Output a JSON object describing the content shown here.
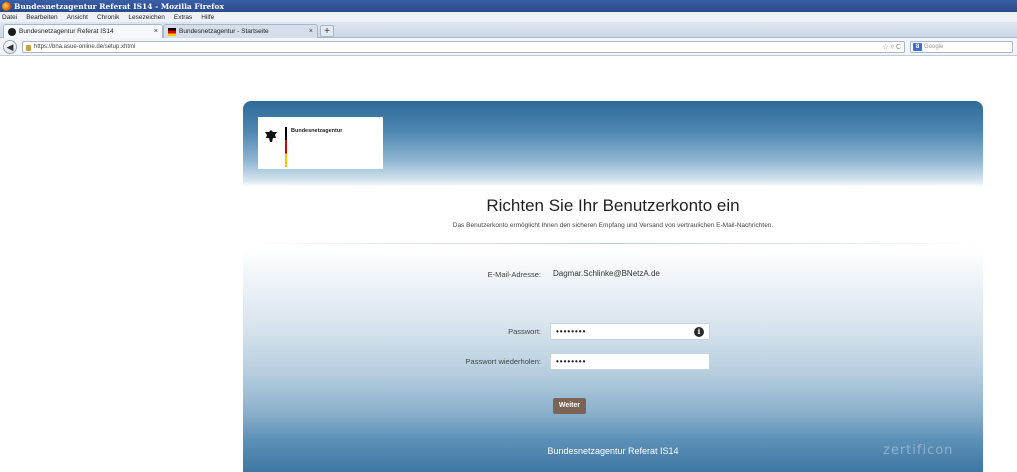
{
  "browser": {
    "window_title": "Bundesnetzagentur Referat IS14 - Mozilla Firefox",
    "menu": [
      "Datei",
      "Bearbeiten",
      "Ansicht",
      "Chronik",
      "Lesezeichen",
      "Extras",
      "Hilfe"
    ],
    "tabs": [
      {
        "label": "Bundesnetzagentur Referat IS14"
      },
      {
        "label": "Bundesnetzagentur - Startseite"
      }
    ],
    "new_tab_label": "+",
    "tab_close": "×",
    "back_symbol": "◀",
    "url": "https://bna.asue-online.de/setup.xhtml",
    "url_tools": "☆ ▿ C",
    "search_engine_letter": "8",
    "search_placeholder": "Google"
  },
  "page": {
    "logo_text": "Bundesnetzagentur",
    "heading": "Richten Sie Ihr Benutzerkonto ein",
    "subheading": "Das Benutzerkonto ermöglicht Ihnen den sicheren Empfang und Versand von vertraulichen E-Mail-Nachrichten.",
    "email_label": "E-Mail-Adresse:",
    "email_value": "Dagmar.Schlinke@BNetzA.de",
    "password_label": "Passwort:",
    "password_value": "••••••••",
    "password_repeat_label": "Passwort wiederholen:",
    "password_repeat_value": "••••••••",
    "info_symbol": "i",
    "submit_label": "Weiter",
    "footer": "Bundesnetzagentur Referat IS14",
    "watermark": "zertificon"
  },
  "colors": {
    "header_blue": "#2e6a99",
    "button_brown": "#7a6455",
    "titlebar_blue": "#3a5fa6"
  }
}
